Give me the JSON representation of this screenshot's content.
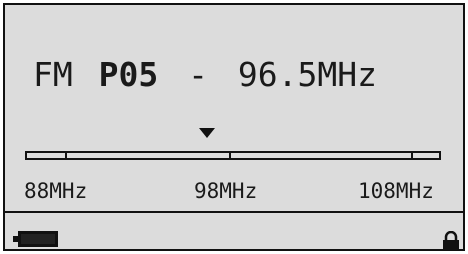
{
  "station": {
    "band": "FM",
    "preset": "P05",
    "separator": "-",
    "frequency": "96.5MHz"
  },
  "tuning_scale": {
    "min_label": "88MHz",
    "mid_label": "98MHz",
    "max_label": "108MHz",
    "current_mhz": 96.5
  },
  "status_bar": {
    "battery_icon": "battery-icon",
    "lock_icon": "lock-icon"
  },
  "colors": {
    "screen_bg": "#dcdcdc",
    "foreground": "#111111"
  }
}
